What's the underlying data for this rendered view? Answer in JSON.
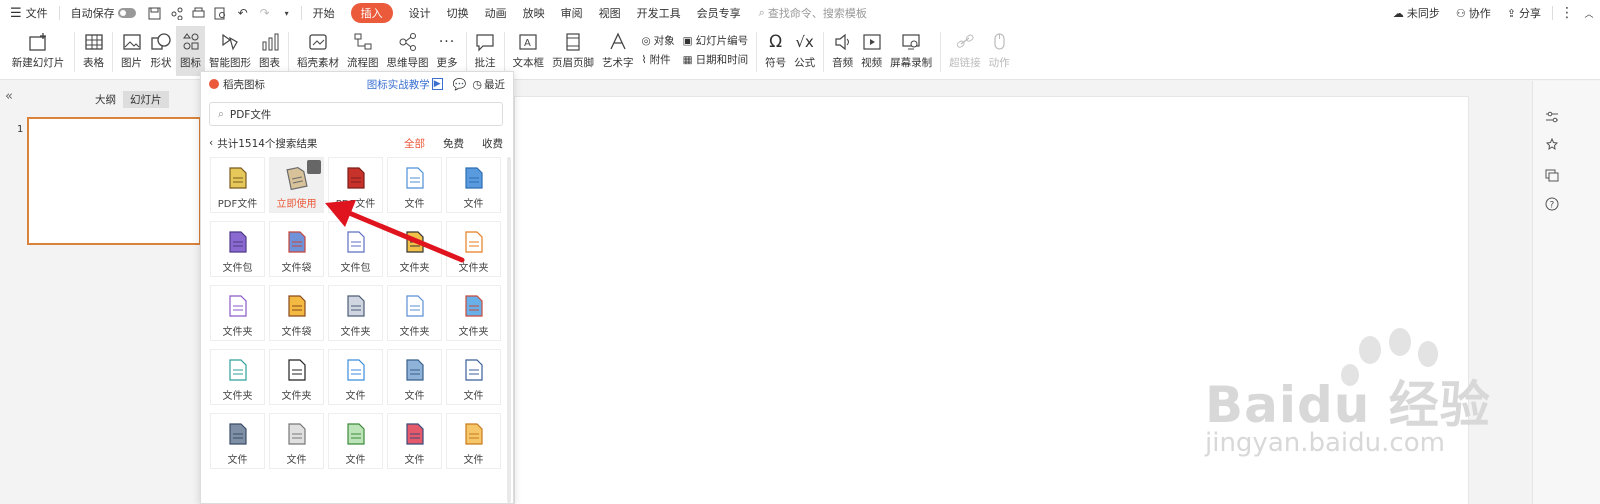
{
  "menubar": {
    "items": [
      "文件",
      "自动保存",
      "开始",
      "插入",
      "设计",
      "切换",
      "动画",
      "放映",
      "审阅",
      "视图",
      "开发工具",
      "会员专享"
    ],
    "search_placeholder": "查找命令、搜索模板",
    "right": [
      "未同步",
      "协作",
      "分享"
    ]
  },
  "ribbon": {
    "new_slide": "新建幻灯片",
    "table": "表格",
    "picture": "图片",
    "shape": "形状",
    "icon": "图标",
    "smartart": "智能图形",
    "chart": "图表",
    "shell_material": "稻壳素材",
    "flowchart": "流程图",
    "mindmap": "思维导图",
    "more": "更多",
    "comment": "批注",
    "textbox": "文本框",
    "header_footer": "页眉页脚",
    "wordart": "艺术字",
    "object": "对象",
    "attachment": "附件",
    "slide_number": "幻灯片编号",
    "date_time": "日期和时间",
    "symbol": "符号",
    "formula": "公式",
    "audio": "音频",
    "video": "视频",
    "screen_record": "屏幕录制",
    "hyperlink": "超链接",
    "action": "动作"
  },
  "left_panel": {
    "tab_outline": "大纲",
    "tab_slides": "幻灯片",
    "slide_number": "1"
  },
  "popup": {
    "title": "稻壳图标",
    "tutorial": "图标实战教学",
    "recent": "最近",
    "search_value": "PDF文件",
    "result_count": "共计1514个搜索结果",
    "filter_all": "全部",
    "filter_free": "免费",
    "filter_favorite": "收费",
    "icons": [
      {
        "label": "PDF文件",
        "icon": "pdf-yellow"
      },
      {
        "label": "立即使用",
        "icon": "pdf-tilted"
      },
      {
        "label": "PDF文件",
        "icon": "pdf-red"
      },
      {
        "label": "文件",
        "icon": "file-heart"
      },
      {
        "label": "文件",
        "icon": "file-blue"
      },
      {
        "label": "文件包",
        "icon": "briefcase-purple"
      },
      {
        "label": "文件袋",
        "icon": "envelope-blue"
      },
      {
        "label": "文件包",
        "icon": "briefcase-outline"
      },
      {
        "label": "文件夹",
        "icon": "folder-dark"
      },
      {
        "label": "文件夹",
        "icon": "folder-orange"
      },
      {
        "label": "文件夹",
        "icon": "doc-list"
      },
      {
        "label": "文件袋",
        "icon": "bag-yellow"
      },
      {
        "label": "文件夹",
        "icon": "folder-gray"
      },
      {
        "label": "文件夹",
        "icon": "folder-heart"
      },
      {
        "label": "文件夹",
        "icon": "folder-blue"
      },
      {
        "label": "文件夹",
        "icon": "doc-teal"
      },
      {
        "label": "文件夹",
        "icon": "doc-outline"
      },
      {
        "label": "文件",
        "icon": "doc-image"
      },
      {
        "label": "文件",
        "icon": "doc-clipboard"
      },
      {
        "label": "文件",
        "icon": "doc-stamp"
      },
      {
        "label": "文件",
        "icon": "printer"
      },
      {
        "label": "文件",
        "icon": "doc-pen"
      },
      {
        "label": "文件",
        "icon": "doc-green"
      },
      {
        "label": "文件",
        "icon": "doc-red"
      },
      {
        "label": "文件",
        "icon": "file-tag"
      }
    ]
  },
  "watermark": {
    "brand": "Baidu 经验",
    "url": "jingyan.baidu.com"
  },
  "colors": {
    "accent": "#ea5a3b",
    "arrow": "#e0141e",
    "thumb_border": "#d9823b"
  }
}
